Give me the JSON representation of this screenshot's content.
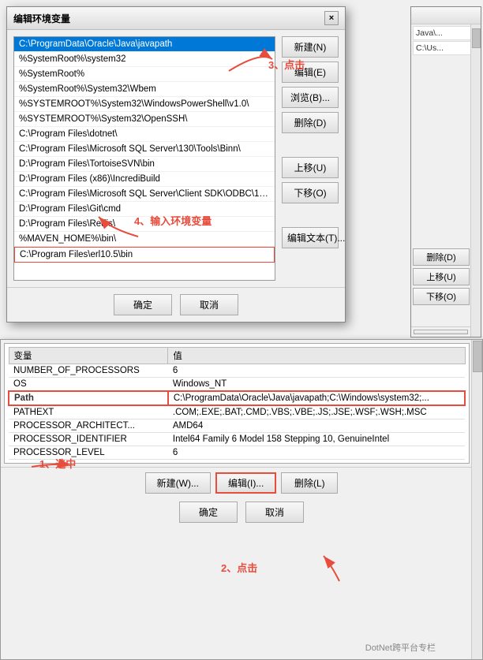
{
  "dialog": {
    "title": "编辑环境变量",
    "close_label": "×",
    "paths": [
      {
        "text": "C:\\ProgramData\\Oracle\\Java\\javapath",
        "selected": true,
        "new_entry": false
      },
      {
        "text": "%SystemRoot%\\system32",
        "selected": false,
        "new_entry": false
      },
      {
        "text": "%SystemRoot%",
        "selected": false,
        "new_entry": false
      },
      {
        "text": "%SystemRoot%\\System32\\Wbem",
        "selected": false,
        "new_entry": false
      },
      {
        "text": "%SYSTEMROOT%\\System32\\WindowsPowerShell\\v1.0\\",
        "selected": false,
        "new_entry": false
      },
      {
        "text": "%SYSTEMROOT%\\System32\\OpenSSH\\",
        "selected": false,
        "new_entry": false
      },
      {
        "text": "C:\\Program Files\\dotnet\\",
        "selected": false,
        "new_entry": false
      },
      {
        "text": "C:\\Program Files\\Microsoft SQL Server\\130\\Tools\\Binn\\",
        "selected": false,
        "new_entry": false
      },
      {
        "text": "D:\\Program Files\\TortoiseSVN\\bin",
        "selected": false,
        "new_entry": false
      },
      {
        "text": "D:\\Program Files (x86)\\IncrediBuild",
        "selected": false,
        "new_entry": false
      },
      {
        "text": "C:\\Program Files\\Microsoft SQL Server\\Client SDK\\ODBC\\170\\T...",
        "selected": false,
        "new_entry": false
      },
      {
        "text": "D:\\Program Files\\Git\\cmd",
        "selected": false,
        "new_entry": false
      },
      {
        "text": "D:\\Program Files\\Redis\\",
        "selected": false,
        "new_entry": false
      },
      {
        "text": "%MAVEN_HOME%\\bin\\",
        "selected": false,
        "new_entry": false
      },
      {
        "text": "C:\\Program Files\\erl10.5\\bin",
        "selected": false,
        "new_entry": true
      }
    ],
    "buttons": {
      "new": "新建(N)",
      "edit": "编辑(E)",
      "browse": "浏览(B)...",
      "delete": "删除(D)",
      "move_up": "上移(U)",
      "move_down": "下移(O)",
      "edit_text": "编辑文本(T)..."
    },
    "footer": {
      "ok": "确定",
      "cancel": "取消"
    }
  },
  "bg_window": {
    "table_headers": [
      "变量",
      "值"
    ],
    "rows": [
      {
        "var": "NUMBER_OF_PROCESSORS",
        "val": "6",
        "selected": false,
        "highlighted": false
      },
      {
        "var": "OS",
        "val": "Windows_NT",
        "selected": false,
        "highlighted": false
      },
      {
        "var": "Path",
        "val": "C:\\ProgramData\\Oracle\\Java\\javapath;C:\\Windows\\system32;...",
        "selected": false,
        "highlighted": true
      },
      {
        "var": "PATHEXT",
        "val": ".COM;.EXE;.BAT;.CMD;.VBS;.VBE;.JS;.JSE;.WSF;.WSH;.MSC",
        "selected": false,
        "highlighted": false
      },
      {
        "var": "PROCESSOR_ARCHITECT...",
        "val": "AMD64",
        "selected": false,
        "highlighted": false
      },
      {
        "var": "PROCESSOR_IDENTIFIER",
        "val": "Intel64 Family 6 Model 158 Stepping 10, GenuineIntel",
        "selected": false,
        "highlighted": false
      },
      {
        "var": "PROCESSOR_LEVEL",
        "val": "6",
        "selected": false,
        "highlighted": false
      }
    ],
    "buttons": {
      "new": "新建(W)...",
      "edit": "编辑(I)...",
      "delete": "删除(L)"
    },
    "footer": {
      "ok": "确定",
      "cancel": "取消"
    }
  },
  "right_window": {
    "items": [
      "Java\\...",
      "C:\\Us..."
    ],
    "buttons": {
      "delete": "删除(D)",
      "move_up": "上移(U)",
      "move_down": "下移(O)"
    }
  },
  "annotations": {
    "step1": "1、选中",
    "step2": "2、点击",
    "step3": "3、点击",
    "step4": "4、输入环境变量"
  },
  "watermark": "DotNet跨平台专栏"
}
